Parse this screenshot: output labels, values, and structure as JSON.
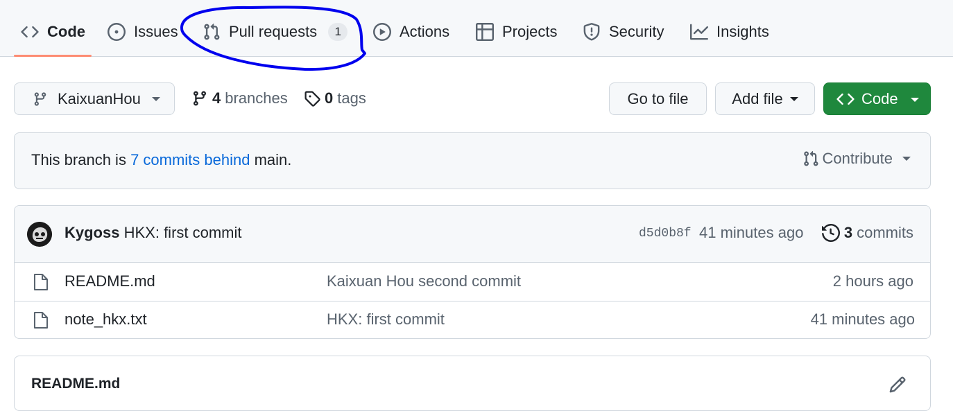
{
  "tabs": [
    {
      "label": "Code",
      "icon": "code-icon",
      "selected": true
    },
    {
      "label": "Issues",
      "icon": "issue-opened-icon"
    },
    {
      "label": "Pull requests",
      "icon": "git-pull-request-icon",
      "counter": "1"
    },
    {
      "label": "Actions",
      "icon": "play-icon"
    },
    {
      "label": "Projects",
      "icon": "table-icon"
    },
    {
      "label": "Security",
      "icon": "shield-icon"
    },
    {
      "label": "Insights",
      "icon": "graph-icon"
    }
  ],
  "annotation": {
    "shape": "hand-drawn ellipse",
    "target": "Pull requests tab",
    "color": "#0000ee"
  },
  "toolbar": {
    "branch_name": "KaixuanHou",
    "branches_count": "4",
    "branches_label": "branches",
    "tags_count": "0",
    "tags_label": "tags",
    "go_to_file": "Go to file",
    "add_file": "Add file",
    "code_button": "Code"
  },
  "banner": {
    "prefix": "This branch is ",
    "link": "7 commits behind",
    "suffix": " main.",
    "contribute": "Contribute"
  },
  "latest_commit": {
    "author": "Kygoss",
    "message": "HKX: first commit",
    "sha": "d5d0b8f",
    "time": "41 minutes ago",
    "commits_count": "3",
    "commits_label": "commits"
  },
  "files": [
    {
      "name": "README.md",
      "commit": "Kaixuan Hou second commit",
      "age": "2 hours ago",
      "icon": "file-icon"
    },
    {
      "name": "note_hkx.txt",
      "commit": "HKX: first commit",
      "age": "41 minutes ago",
      "icon": "file-icon"
    }
  ],
  "readme": {
    "title": "README.md"
  },
  "colors": {
    "primary_button": "#1f883d",
    "link": "#0969da",
    "tab_underline": "#fd8c73"
  }
}
